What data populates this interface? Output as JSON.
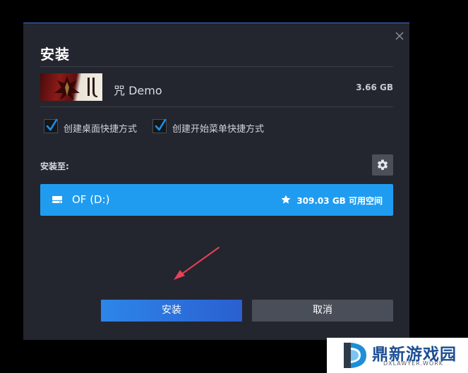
{
  "dialog": {
    "title": "安装",
    "close_icon": "close-icon"
  },
  "game": {
    "name": "咒 Demo",
    "size": "3.66 GB"
  },
  "options": [
    {
      "label": "创建桌面快捷方式",
      "checked": true
    },
    {
      "label": "创建开始菜单快捷方式",
      "checked": true
    }
  ],
  "install_location": {
    "label": "安装至:",
    "settings_icon": "gear-icon",
    "drive": {
      "name": "OF (D:)",
      "free_space": "309.03 GB 可用空间",
      "icon": "drive-icon",
      "favorite_icon": "star-icon"
    }
  },
  "buttons": {
    "install": "安装",
    "cancel": "取消"
  },
  "watermark": {
    "title": "鼎新游戏园",
    "subtitle": "DXLAWYER.WORK"
  },
  "colors": {
    "accent": "#1f9cf0",
    "dialog_bg": "#23262e",
    "install_button": "#2a6fdc",
    "cancel_button": "#4a4e58",
    "annotation_arrow": "#e8405a"
  }
}
